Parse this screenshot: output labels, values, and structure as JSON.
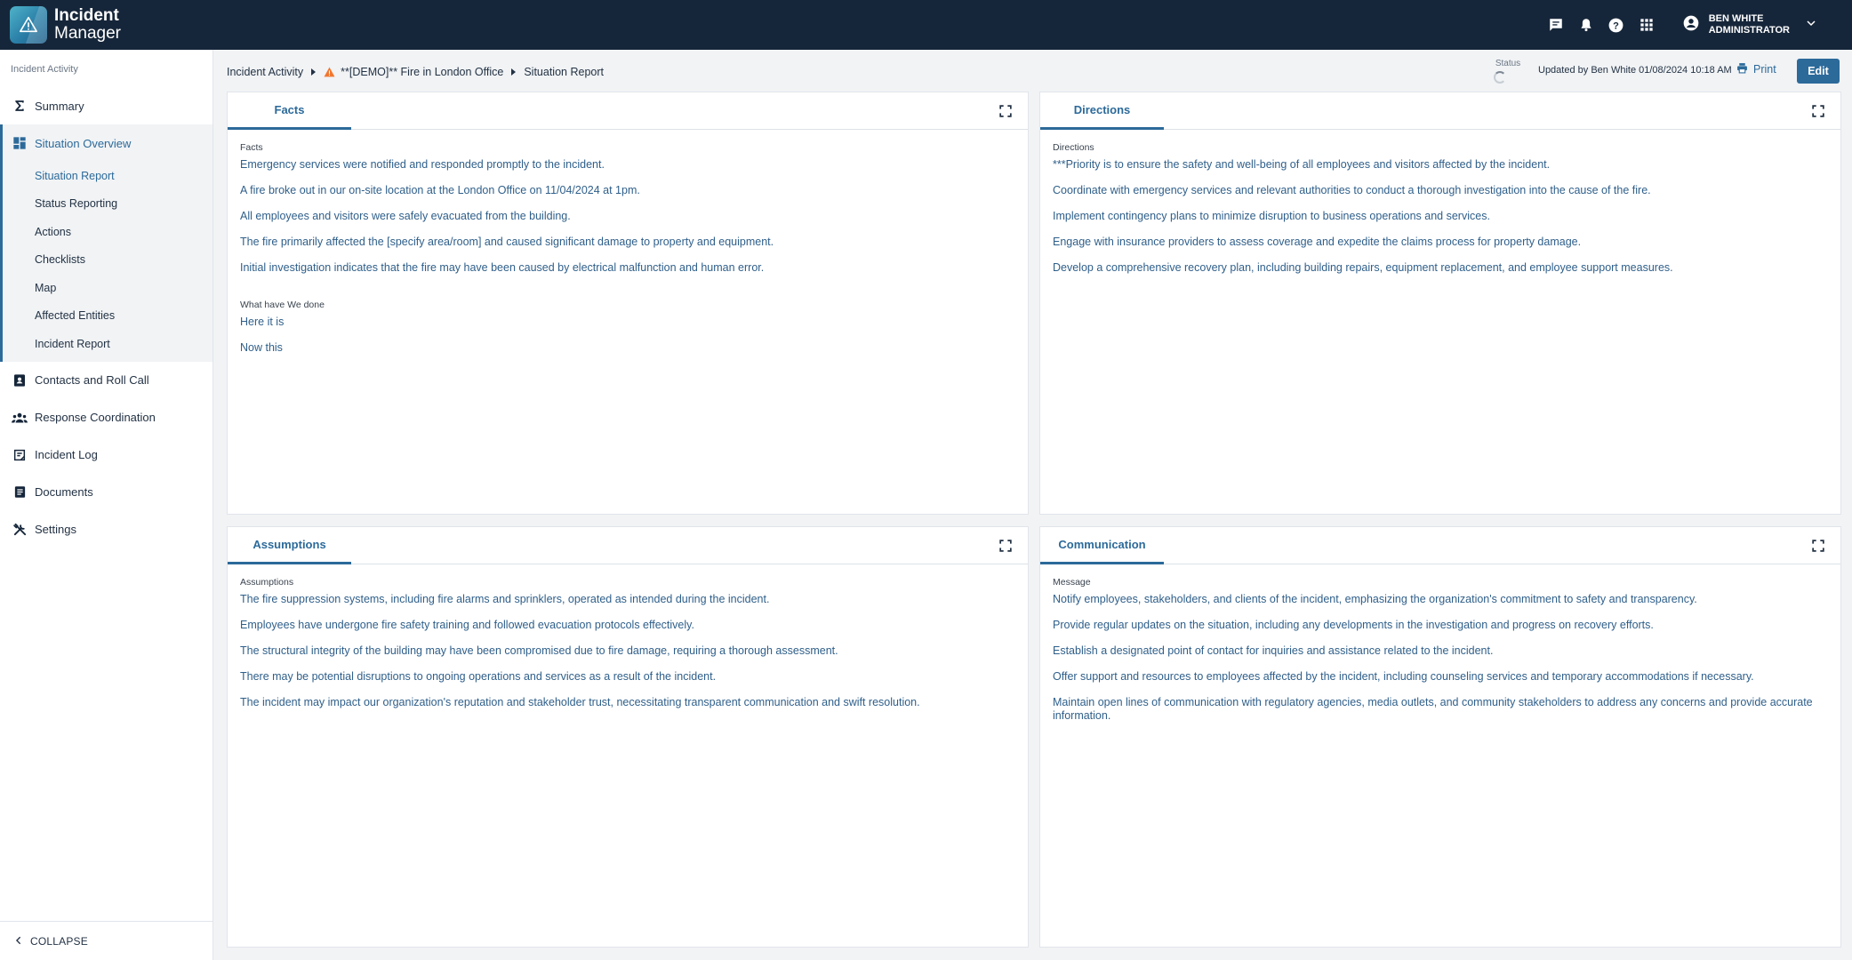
{
  "app": {
    "logo_line1": "Incident",
    "logo_line2": "Manager",
    "accent_color": "#2c6a9a",
    "topbar_color": "#16263a"
  },
  "topbar": {
    "icons": [
      "chat-icon",
      "bell-icon",
      "help-icon",
      "apps-grid-icon"
    ],
    "user": {
      "name": "BEN WHITE",
      "role": "ADMINISTRATOR"
    }
  },
  "sidebar": {
    "header": "Incident Activity",
    "summary": "Summary",
    "situation_overview": "Situation Overview",
    "sub_items": [
      "Situation Report",
      "Status Reporting",
      "Actions",
      "Checklists",
      "Map",
      "Affected Entities",
      "Incident Report"
    ],
    "bottom_items": [
      "Contacts and Roll Call",
      "Response Coordination",
      "Incident Log",
      "Documents",
      "Settings"
    ],
    "collapse_label": "COLLAPSE"
  },
  "breadcrumb": {
    "root": "Incident Activity",
    "incident": "**[DEMO]** Fire in London Office",
    "page": "Situation Report"
  },
  "header": {
    "status_label": "Status",
    "updated_text": "Updated by Ben White 01/08/2024 10:18 AM",
    "print_label": "Print",
    "edit_label": "Edit"
  },
  "panels": {
    "facts": {
      "tab": "Facts",
      "groups": [
        {
          "label": "Facts",
          "items": [
            "Emergency services were notified and responded promptly to the incident.",
            "A fire broke out in our on-site location at the London Office on 11/04/2024 at 1pm.",
            "All employees and visitors were safely evacuated from the building.",
            "The fire primarily affected the [specify area/room] and caused significant damage to property and equipment.",
            "Initial investigation indicates that the fire may have been caused by electrical malfunction and human error."
          ]
        },
        {
          "label": "What have We done",
          "items": [
            "Here it is",
            "Now this"
          ]
        }
      ]
    },
    "directions": {
      "tab": "Directions",
      "groups": [
        {
          "label": "Directions",
          "items": [
            "***Priority is to ensure the safety and well-being of all employees and visitors affected by the incident.",
            "Coordinate with emergency services and relevant authorities to conduct a thorough investigation into the cause of the fire.",
            "Implement contingency plans to minimize disruption to business operations and services.",
            "Engage with insurance providers to assess coverage and expedite the claims process for property damage.",
            "Develop a comprehensive recovery plan, including building repairs, equipment replacement, and employee support measures."
          ]
        }
      ]
    },
    "assumptions": {
      "tab": "Assumptions",
      "groups": [
        {
          "label": "Assumptions",
          "items": [
            "The fire suppression systems, including fire alarms and sprinklers, operated as intended during the incident.",
            "Employees have undergone fire safety training and followed evacuation protocols effectively.",
            "The structural integrity of the building may have been compromised due to fire damage, requiring a thorough assessment.",
            "There may be potential disruptions to ongoing operations and services as a result of the incident.",
            "The incident may impact our organization's reputation and stakeholder trust, necessitating transparent communication and swift resolution."
          ]
        }
      ]
    },
    "communication": {
      "tab": "Communication",
      "groups": [
        {
          "label": "Message",
          "items": [
            "Notify employees, stakeholders, and clients of the incident, emphasizing the organization's commitment to safety and transparency.",
            "Provide regular updates on the situation, including any developments in the investigation and progress on recovery efforts.",
            "Establish a designated point of contact for inquiries and assistance related to the incident.",
            "Offer support and resources to employees affected by the incident, including counseling services and temporary accommodations if necessary.",
            "Maintain open lines of communication with regulatory agencies, media outlets, and community stakeholders to address any concerns and provide accurate information."
          ]
        }
      ]
    }
  }
}
